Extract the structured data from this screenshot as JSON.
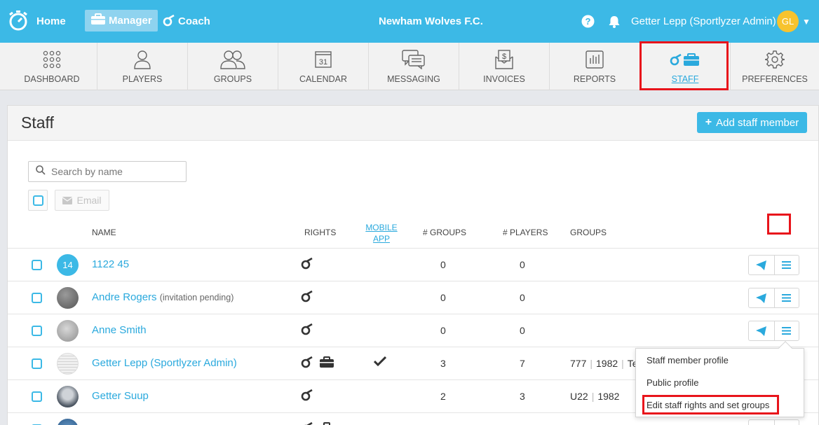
{
  "topbar": {
    "home": "Home",
    "manager": "Manager",
    "coach": "Coach",
    "club": "Newham Wolves F.C.",
    "user": "Getter Lepp (Sportlyzer Admin)",
    "initials": "GL",
    "accent": "#3cb9e6"
  },
  "nav": [
    {
      "label": "DASHBOARD",
      "icon": "grid-icon"
    },
    {
      "label": "PLAYERS",
      "icon": "person-icon"
    },
    {
      "label": "GROUPS",
      "icon": "people-icon"
    },
    {
      "label": "CALENDAR",
      "icon": "calendar-icon",
      "day": "31"
    },
    {
      "label": "MESSAGING",
      "icon": "chat-icon"
    },
    {
      "label": "INVOICES",
      "icon": "invoice-icon"
    },
    {
      "label": "REPORTS",
      "icon": "bar-chart-icon"
    },
    {
      "label": "STAFF",
      "icon": "whistle-briefcase-icon",
      "active": true
    },
    {
      "label": "PREFERENCES",
      "icon": "gear-icon"
    }
  ],
  "page": {
    "title": "Staff",
    "add_button": "Add staff member",
    "search_placeholder": "Search by name",
    "email_button": "Email"
  },
  "columns": {
    "name": "NAME",
    "rights": "RIGHTS",
    "mobile_line1": "MOBILE",
    "mobile_line2": "APP",
    "groups_count": "# GROUPS",
    "players_count": "# PLAYERS",
    "groups": "GROUPS"
  },
  "rows": [
    {
      "avatar_text": "14",
      "name": "1122 45",
      "note": "",
      "groups_count": "0",
      "players_count": "0",
      "groups": []
    },
    {
      "avatar_text": "",
      "name": "Andre Rogers",
      "note": "(invitation pending)",
      "groups_count": "0",
      "players_count": "0",
      "groups": []
    },
    {
      "avatar_text": "",
      "name": "Anne Smith",
      "note": "",
      "groups_count": "0",
      "players_count": "0",
      "groups": []
    },
    {
      "avatar_text": "",
      "name": "Getter Lepp (Sportlyzer Admin)",
      "note": "",
      "groups_count": "3",
      "players_count": "7",
      "groups": [
        "777",
        "1982",
        "Te"
      ],
      "mobile_app": true,
      "manager_right": true
    },
    {
      "avatar_text": "",
      "name": "Getter Suup",
      "note": "",
      "groups_count": "2",
      "players_count": "3",
      "groups": [
        "U22",
        "1982"
      ]
    }
  ],
  "dropdown": [
    "Staff member profile",
    "Public profile",
    "Edit staff rights and set groups"
  ]
}
